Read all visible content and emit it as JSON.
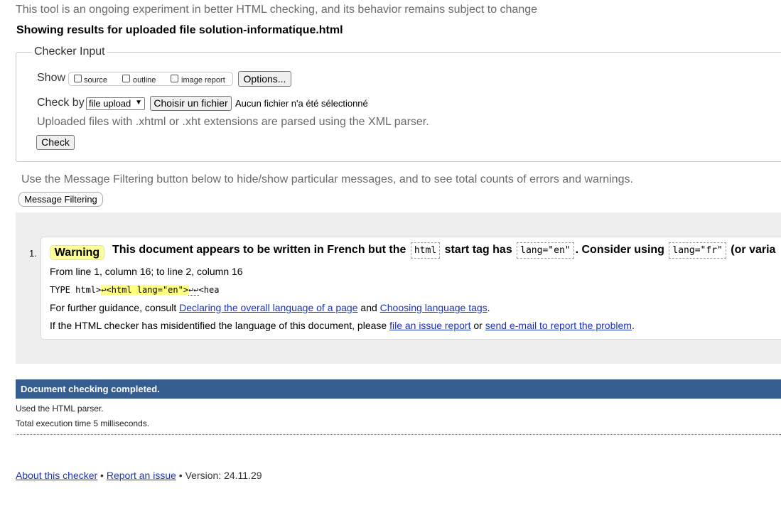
{
  "intro": "This tool is an ongoing experiment in better HTML checking, and its behavior remains subject to change",
  "results_heading": "Showing results for uploaded file solution-informatique.html",
  "checker": {
    "legend": "Checker Input",
    "show_label": "Show",
    "show_options": [
      {
        "label": "source",
        "checked": false
      },
      {
        "label": "outline",
        "checked": false
      },
      {
        "label": "image report",
        "checked": false
      }
    ],
    "options_button": "Options...",
    "check_by_label": "Check by",
    "check_by_selected": "file upload",
    "choose_file_button": "Choisir un fichier",
    "no_file_text": "Aucun fichier n'a été sélectionné",
    "xml_note": "Uploaded files with .xhtml or .xht extensions are parsed using the XML parser.",
    "check_button": "Check"
  },
  "filter_note": "Use the Message Filtering button below to hide/show particular messages, and to see total counts of errors and warnings.",
  "message_filtering_button": "Message Filtering",
  "messages": [
    {
      "number": "1.",
      "type": "Warning",
      "title_parts": {
        "a": "This document appears to be written in French but the ",
        "code1": "html",
        "b": " start tag has ",
        "code2": "lang=\"en\"",
        "c": ". Consider using ",
        "code3": "lang=\"fr\"",
        "d": " (or varia"
      },
      "location": "From line 1, column 16; to line 2, column 16",
      "extract": {
        "pre": "TYPE html>",
        "highlight": "↩<html lang=\"en\">",
        "post_marks": "↩↩",
        "post": "<hea"
      },
      "guidance": {
        "prefix": "For further guidance, consult ",
        "link1": "Declaring the overall language of a page",
        "mid": " and ",
        "link2": "Choosing language tags",
        "suffix": "."
      },
      "misidentified": {
        "prefix": "If the HTML checker has misidentified the language of this document, please ",
        "link1": "file an issue report",
        "mid": " or ",
        "link2": "send e-mail to report the problem",
        "suffix": "."
      }
    }
  ],
  "completed": "Document checking completed.",
  "parser_note": "Used the HTML parser.",
  "exec_time": "Total execution time 5 milliseconds.",
  "footer": {
    "about": "About this checker",
    "bullet1": " • ",
    "report": "Report an issue",
    "bullet2": " • ",
    "version": "Version: 24.11.29"
  },
  "colors": {
    "completed_bar": "#365d8f",
    "warning_badge": "#ffff99",
    "link": "#1a33bb"
  }
}
